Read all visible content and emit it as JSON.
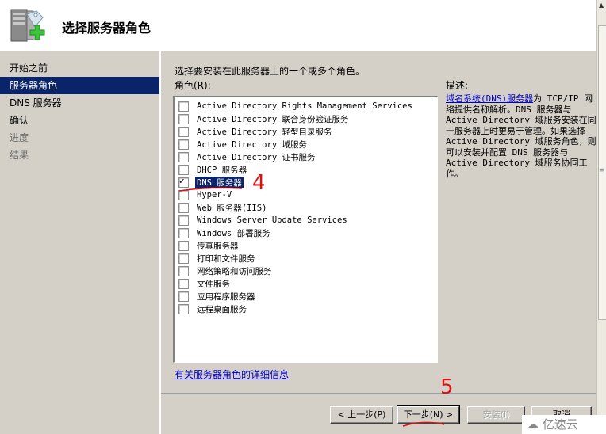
{
  "header": {
    "title": "选择服务器角色",
    "icon": "server-add-icon"
  },
  "sidebar": {
    "items": [
      {
        "label": "开始之前",
        "state": "normal"
      },
      {
        "label": "服务器角色",
        "state": "active"
      },
      {
        "label": "DNS 服务器",
        "state": "normal"
      },
      {
        "label": "确认",
        "state": "normal"
      },
      {
        "label": "进度",
        "state": "disabled"
      },
      {
        "label": "结果",
        "state": "disabled"
      }
    ]
  },
  "main": {
    "instruction": "选择要安装在此服务器上的一个或多个角色。",
    "roles_label": "角色(R):",
    "roles": [
      {
        "label": "Active Directory Rights Management Services",
        "checked": false
      },
      {
        "label": "Active Directory 联合身份验证服务",
        "checked": false
      },
      {
        "label": "Active Directory 轻型目录服务",
        "checked": false
      },
      {
        "label": "Active Directory 域服务",
        "checked": false
      },
      {
        "label": "Active Directory 证书服务",
        "checked": false
      },
      {
        "label": "DHCP 服务器",
        "checked": false
      },
      {
        "label": "DNS 服务器",
        "checked": true,
        "selected": true
      },
      {
        "label": "Hyper-V",
        "checked": false
      },
      {
        "label": "Web 服务器(IIS)",
        "checked": false
      },
      {
        "label": "Windows Server Update Services",
        "checked": false
      },
      {
        "label": "Windows 部署服务",
        "checked": false
      },
      {
        "label": "传真服务器",
        "checked": false
      },
      {
        "label": "打印和文件服务",
        "checked": false
      },
      {
        "label": "网络策略和访问服务",
        "checked": false
      },
      {
        "label": "文件服务",
        "checked": false
      },
      {
        "label": "应用程序服务器",
        "checked": false
      },
      {
        "label": "远程桌面服务",
        "checked": false
      }
    ],
    "description": {
      "title": "描述:",
      "link": "域名系统(DNS)服务器",
      "text": "为 TCP/IP 网络提供名称解析。DNS 服务器与 Active Directory 域服务安装在同一服务器上时更易于管理。如果选择 Active Directory 域服务角色，则可以安装并配置 DNS 服务器与 Active Directory 域服务协同工作。"
    },
    "more_info_link": "有关服务器角色的详细信息"
  },
  "footer": {
    "buttons": {
      "previous": "< 上一步(P)",
      "next": "下一步(N) >",
      "install": "安装(I)",
      "cancel": "取消"
    }
  },
  "annotations": {
    "step4": "4",
    "step5": "5",
    "color": "#e01010"
  },
  "watermark": "亿速云"
}
